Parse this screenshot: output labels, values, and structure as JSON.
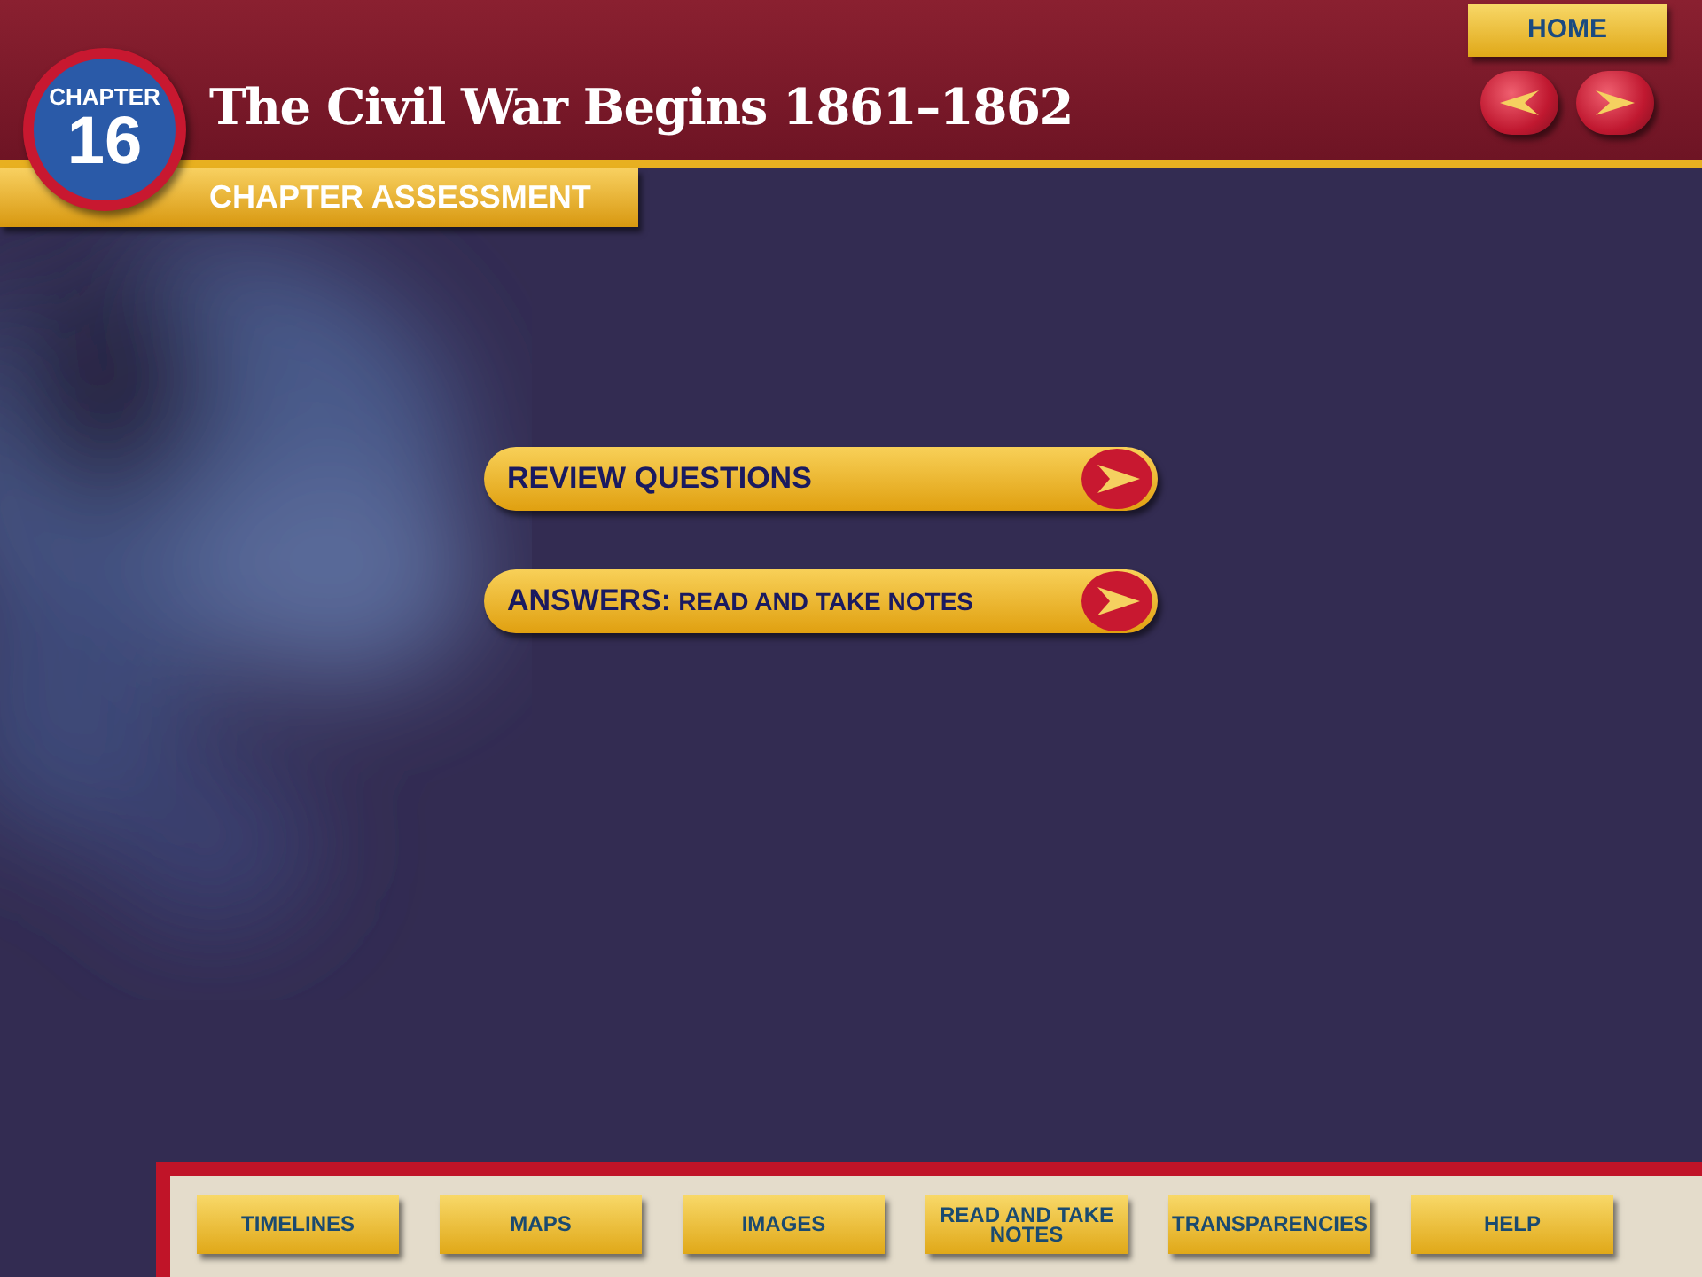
{
  "header": {
    "chapter_label": "CHAPTER",
    "chapter_number": "16",
    "title": "The Civil War Begins 1861–1862",
    "section": "CHAPTER ASSESSMENT",
    "home": "HOME"
  },
  "options": [
    {
      "label": "REVIEW QUESTIONS"
    },
    {
      "label": "ANSWERS:",
      "sublabel": "READ AND TAKE NOTES"
    }
  ],
  "nav_bar": [
    "TIMELINES",
    "MAPS",
    "IMAGES",
    "READ AND TAKE NOTES",
    "TRANSPARENCIES",
    "HELP"
  ]
}
